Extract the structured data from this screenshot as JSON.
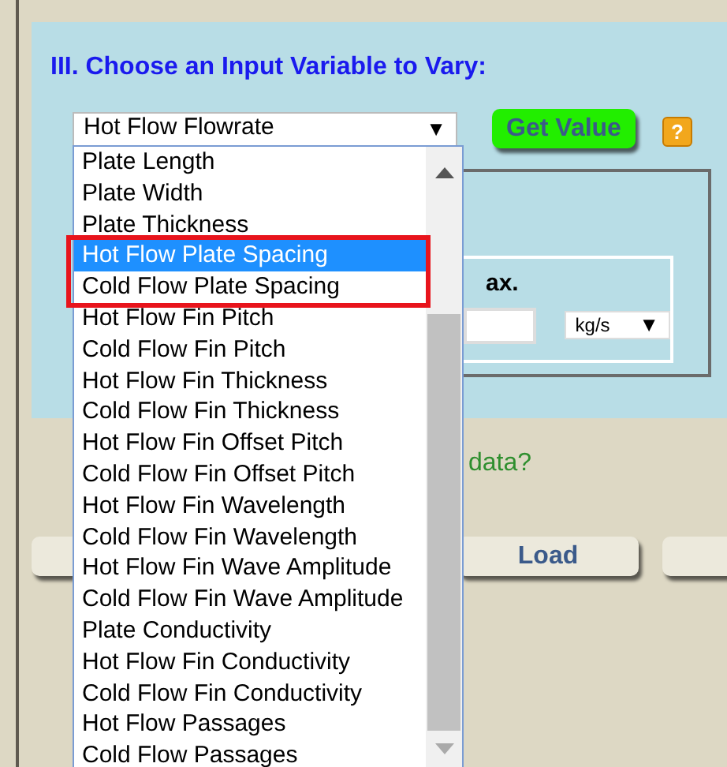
{
  "section_title": "III. Choose an Input Variable to Vary:",
  "variable_select": {
    "value": "Hot Flow Flowrate",
    "arrow": "▼"
  },
  "get_value_button": "Get Value",
  "help_icon": "?",
  "range_panel": {
    "label_fragment": "ax.",
    "unit_select": {
      "value": "kg/s",
      "arrow": "▼"
    }
  },
  "data_prompt": "data?",
  "load_button": "Load",
  "dropdown": {
    "options": [
      {
        "label": "Plate Length",
        "selected": false,
        "outlined": false
      },
      {
        "label": "Plate Width",
        "selected": false,
        "outlined": false
      },
      {
        "label": "Plate Thickness",
        "selected": false,
        "outlined": false
      },
      {
        "label": "Hot Flow Plate Spacing",
        "selected": true,
        "outlined": true
      },
      {
        "label": "Cold Flow Plate Spacing",
        "selected": false,
        "outlined": true
      },
      {
        "label": "Hot Flow Fin Pitch",
        "selected": false,
        "outlined": false
      },
      {
        "label": "Cold Flow Fin Pitch",
        "selected": false,
        "outlined": false
      },
      {
        "label": "Hot Flow Fin Thickness",
        "selected": false,
        "outlined": false
      },
      {
        "label": "Cold Flow Fin Thickness",
        "selected": false,
        "outlined": false
      },
      {
        "label": "Hot Flow Fin Offset Pitch",
        "selected": false,
        "outlined": false
      },
      {
        "label": "Cold Flow Fin Offset Pitch",
        "selected": false,
        "outlined": false
      },
      {
        "label": "Hot Flow Fin Wavelength",
        "selected": false,
        "outlined": false
      },
      {
        "label": "Cold Flow Fin Wavelength",
        "selected": false,
        "outlined": false
      },
      {
        "label": "Hot Flow Fin Wave Amplitude",
        "selected": false,
        "outlined": false
      },
      {
        "label": "Cold Flow Fin Wave Amplitude",
        "selected": false,
        "outlined": false
      },
      {
        "label": "Plate Conductivity",
        "selected": false,
        "outlined": false
      },
      {
        "label": "Hot Flow Fin Conductivity",
        "selected": false,
        "outlined": false
      },
      {
        "label": "Cold Flow Fin Conductivity",
        "selected": false,
        "outlined": false
      },
      {
        "label": "Hot Flow Passages",
        "selected": false,
        "outlined": false
      },
      {
        "label": "Cold Flow Passages",
        "selected": false,
        "outlined": false
      }
    ]
  }
}
